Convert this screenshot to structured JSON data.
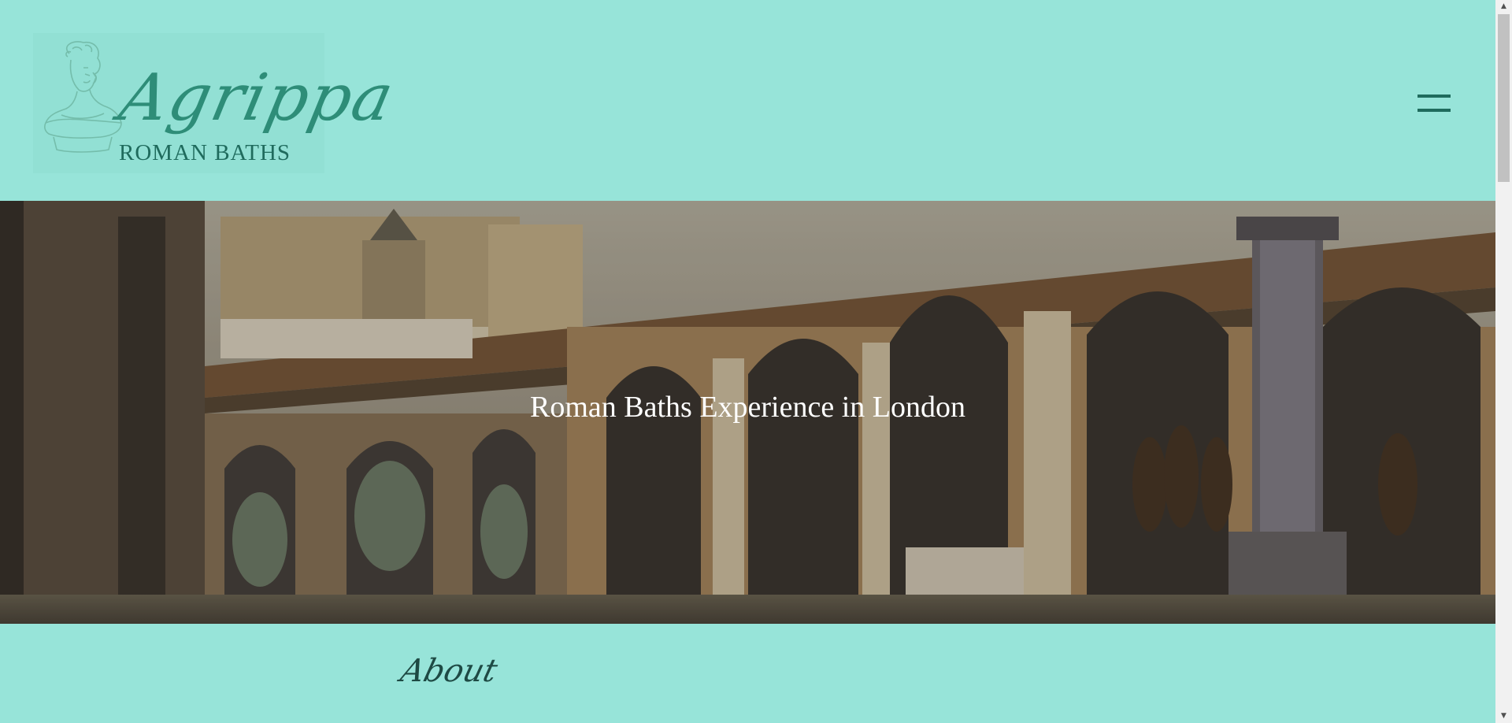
{
  "header": {
    "logo": {
      "script_text": "Agrippa",
      "subtitle": "ROMAN BATHS",
      "icon": "roman-bust-icon"
    },
    "menu_icon": "hamburger-menu-icon"
  },
  "hero": {
    "title": "Roman Baths Experience in London",
    "image": "watercolor-roman-bath-colonnade"
  },
  "about": {
    "heading": "About"
  },
  "colors": {
    "background": "#97e4d9",
    "accent_dark": "#1f6b5d",
    "logo_script": "#2e8d78",
    "hero_text": "#ffffff"
  },
  "scrollbar": {
    "up_icon": "scroll-up-arrow-icon",
    "down_icon": "scroll-down-arrow-icon"
  }
}
